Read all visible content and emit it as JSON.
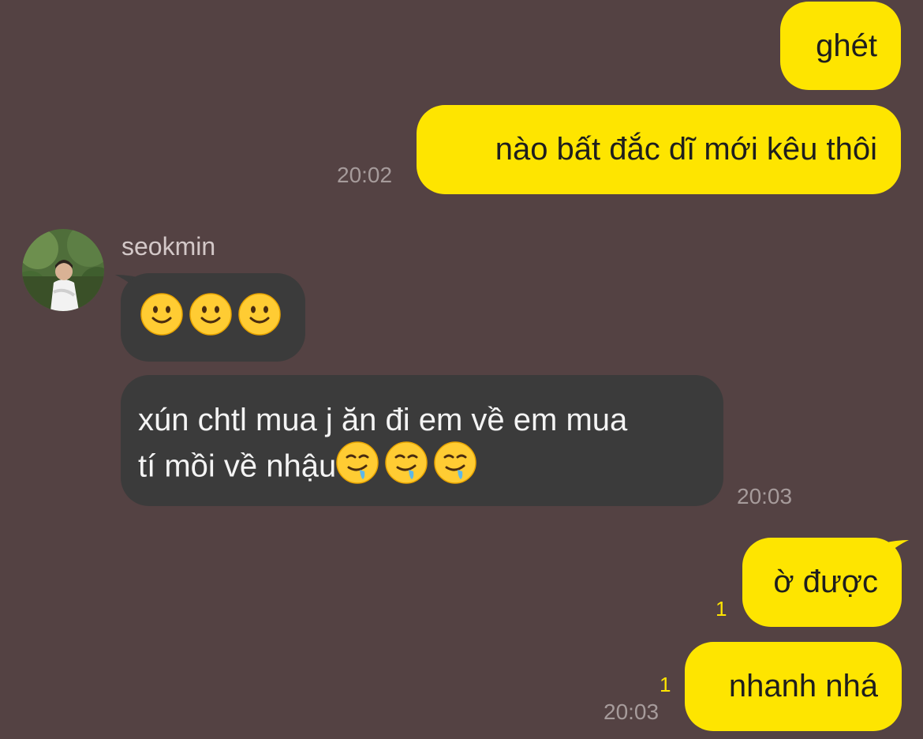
{
  "messages": [
    {
      "text": "ghét"
    },
    {
      "text": "nào bất đắc dĩ mới kêu thôi",
      "time": "20:02"
    },
    {
      "sender": "seokmin",
      "emojis": [
        "slightly-smiling-face",
        "slightly-smiling-face",
        "slightly-smiling-face"
      ]
    },
    {
      "line1": "xún chtl mua j ăn đi em về em mua",
      "line2": "tí mồi về nhậu",
      "emojis": [
        "drooling-face",
        "drooling-face",
        "drooling-face"
      ],
      "time": "20:03"
    },
    {
      "text": "ờ được",
      "unread": "1"
    },
    {
      "text": "nhanh nhá",
      "unread": "1",
      "time": "20:03"
    }
  ],
  "colors": {
    "background": "#544243",
    "outgoing_bubble": "#fee500",
    "incoming_bubble": "#3b3b3b",
    "unread_count": "#fee500"
  }
}
